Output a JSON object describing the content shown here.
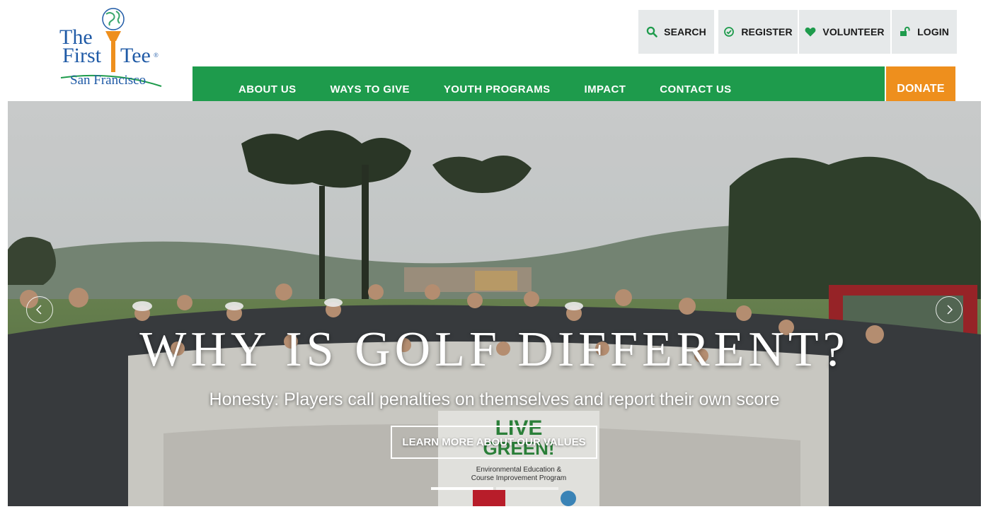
{
  "logo": {
    "line1": "The",
    "line2a": "First",
    "line2b": "Tee",
    "mark": "®",
    "line3": "San Francisco"
  },
  "utility_nav": [
    {
      "label": "SEARCH",
      "icon": "search-icon"
    },
    {
      "label": "REGISTER",
      "icon": "check-circle-icon"
    },
    {
      "label": "VOLUNTEER",
      "icon": "heart-icon"
    },
    {
      "label": "LOGIN",
      "icon": "unlock-icon"
    }
  ],
  "main_nav": [
    {
      "label": "ABOUT US"
    },
    {
      "label": "WAYS TO GIVE"
    },
    {
      "label": "YOUTH PROGRAMS"
    },
    {
      "label": "IMPACT"
    },
    {
      "label": "CONTACT US"
    }
  ],
  "donate_label": "DONATE",
  "hero": {
    "headline": "WHY IS GOLF DIFFERENT?",
    "subheadline": "Honesty: Players call penalties on themselves and report their own score",
    "cta_label": "LEARN MORE ABOUT OUR VALUES",
    "banner_line1": "LIVE",
    "banner_line2": "GREEN!",
    "banner_line3": "Environmental Education &",
    "banner_line4": "Course Improvement Program",
    "slide_count": 2,
    "active_slide": 1
  },
  "colors": {
    "nav_green": "#1e9b4c",
    "donate_orange": "#ee8f1d",
    "utility_gray": "#e6e9ea",
    "brand_blue": "#1f5aa6",
    "icon_green": "#1e9b4c"
  }
}
